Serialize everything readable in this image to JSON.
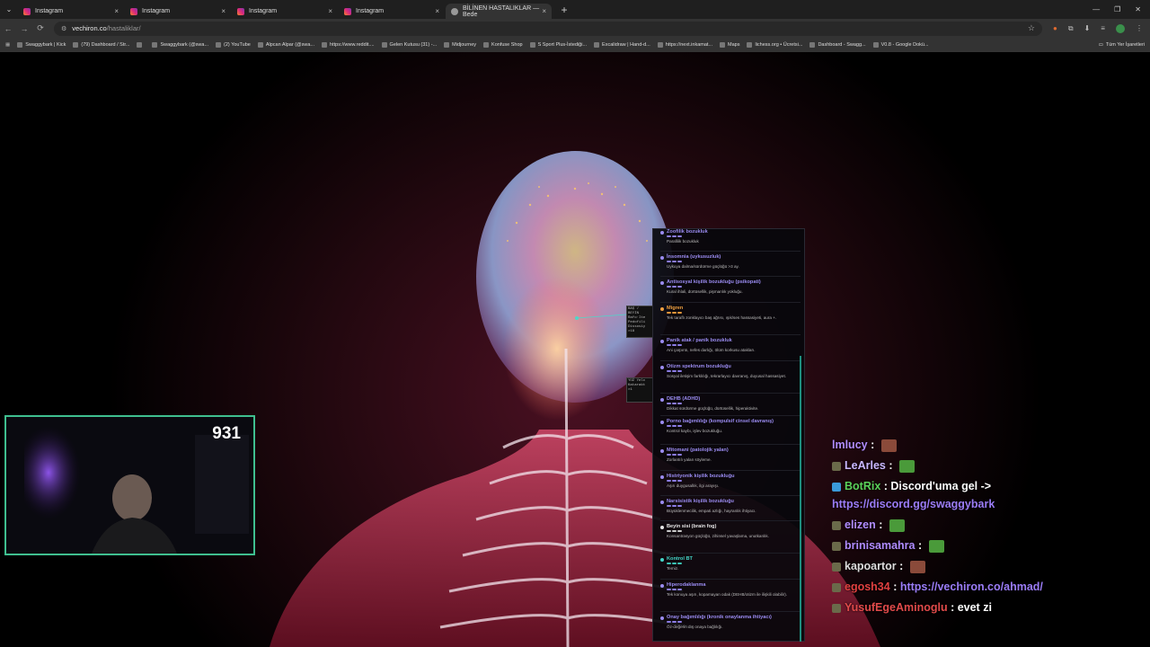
{
  "browser": {
    "tabs": [
      {
        "label": "Instagram",
        "close": "×"
      },
      {
        "label": "Instagram",
        "close": "×"
      },
      {
        "label": "Instagram",
        "close": "×"
      },
      {
        "label": "Instagram",
        "close": "×"
      },
      {
        "label": "BİLİNEN HASTALIKLAR — Bede",
        "close": "×"
      }
    ],
    "new_tab": "+",
    "url_host": "vechiron.co",
    "url_path": "/hastaliklar/",
    "bookmarks": [
      "Swaggybark | Kick",
      "(79) Dashboard / Str...",
      "",
      "Swaggybark (@swa...",
      "(2) YouTube",
      "Alpcan Alpar (@swa...",
      "https://www.reddit....",
      "Gelen Kutusu (31) -...",
      "Midjourney",
      "Konfuse Shop",
      "S Sport Plus-İstediği...",
      "Excalidraw | Hand-d...",
      "https://next.inkamat...",
      "Maps",
      "lichess.org • Ücretsi...",
      "Dashboard - Swagg...",
      "V0.8 - Google Dokü..."
    ],
    "all_bookmarks": "Tüm Yer İşaretleri"
  },
  "panel": {
    "items": [
      {
        "name": "Zoofilik bozukluk",
        "desc": "Parafilik bozukluk",
        "color": "#9b8cf2",
        "bar": "#8c7de6"
      },
      {
        "name": "İnsomnia (uykusuzluk)",
        "desc": "Uykuya dalma/sürdürme güçlüğü >3 ay.",
        "color": "#9b8cf2",
        "bar": "#8c7de6"
      },
      {
        "name": "Antisosyal kişilik bozukluğu (psikopati)",
        "desc": "Kural ihlali, dürtüsellik, pişmanlık yokluğu.",
        "color": "#9b8cf2",
        "bar": "#8c7de6"
      },
      {
        "name": "Migren",
        "desc": "Tek taraflı zonklayıcı baş ağrısı, ışık/ses hassasiyeti, aura +.",
        "color": "#f0a040",
        "bar": "#e8963a"
      },
      {
        "name": "Panik atak / panik bozukluk",
        "desc": "Ani çarpıntı, nefes darlığı, ölüm korkusu atakları.",
        "color": "#9b8cf2",
        "bar": "#8c7de6"
      },
      {
        "name": "Otizm spektrum bozukluğu",
        "desc": "Sosyal iletişim farklılığı, tekrarlayıcı davranış, duyusal hassasiyet.",
        "color": "#9b8cf2",
        "bar": "#8c7de6"
      },
      {
        "name": "DEHB (ADHD)",
        "desc": "Dikkat sürdürme güçlüğü, dürtüsellik, hiperaktivite.",
        "color": "#9b8cf2",
        "bar": "#8c7de6"
      },
      {
        "name": "Porno bağımlılığı (kompulsif cinsel davranış)",
        "desc": "Kontrol kaybı, işlev bozukluğu.",
        "color": "#9b8cf2",
        "bar": "#8c7de6"
      },
      {
        "name": "Mitomani (patolojik yalan)",
        "desc": "Zorlantılı yalan söyleme.",
        "color": "#9b8cf2",
        "bar": "#8c7de6"
      },
      {
        "name": "Histriyonik kişilik bozukluğu",
        "desc": "Aşırı duygusallık, ilgi arayışı.",
        "color": "#9b8cf2",
        "bar": "#8c7de6"
      },
      {
        "name": "Narsisistik kişilik bozukluğu",
        "desc": "Büyüklenmecilik, empati azlığı, hayranlık ihtiyacı.",
        "color": "#9b8cf2",
        "bar": "#8c7de6"
      },
      {
        "name": "Beyin sisi (brain fog)",
        "desc": "Konsantrasyon güçlüğü, zihinsel yavaşlama, unutkanlık.",
        "color": "#e6e6e6",
        "bar": "#cccccc"
      },
      {
        "name": "Kontrol BT",
        "desc": "Temiz.",
        "color": "#44d6c8",
        "bar": "#3cc4b6"
      },
      {
        "name": "Hiperodaklanma",
        "desc": "Tek konuya aşırı, kopamayan odak (DEHB/otizm ile ilişkili olabilir).",
        "color": "#9b8cf2",
        "bar": "#8c7de6"
      },
      {
        "name": "Onay bağımlılığı (kronik onaylanma ihtiyacı)",
        "desc": "Öz-değerin dış onaya bağlılığı.",
        "color": "#9b8cf2",
        "bar": "#8c7de6"
      }
    ]
  },
  "overlays": {
    "label1": "BAŞ / BEYİN Rafo·Ite Pedofili Dissosiy ×18",
    "label2": "YÜZ Yelc Katarakt ×1"
  },
  "webcam": {
    "count": "931"
  },
  "chat": [
    {
      "user": "lmlucy",
      "user_color": "#b08cff",
      "text": "",
      "link": false
    },
    {
      "user": "LeArles",
      "user_color": "#c9b8ff",
      "text": "",
      "link": false
    },
    {
      "user": "BotRix",
      "user_color": "#5ad15a",
      "text": "Discord'uma gel ->",
      "link": false
    },
    {
      "user": "",
      "user_color": "",
      "text": "https://discord.gg/swaggybark",
      "link": true
    },
    {
      "user": "elizen",
      "user_color": "#b08cff",
      "text": "",
      "link": false
    },
    {
      "user": "brinisamahra",
      "user_color": "#b08cff",
      "text": "",
      "link": false
    },
    {
      "user": "kapoartor",
      "user_color": "#dddddd",
      "text": "",
      "link": false
    },
    {
      "user": "egosh34",
      "user_color": "#e04040",
      "text": "https://vechiron.co/ahmad/",
      "link": true
    },
    {
      "user": "YusufEgeAminoglu",
      "user_color": "#e04a4a",
      "text": "evet zi",
      "link": false
    }
  ],
  "colors": {
    "accent_link": "#9a7cf6",
    "page_glow": "#4a1022",
    "panel_scroll": "#1f8f80"
  }
}
